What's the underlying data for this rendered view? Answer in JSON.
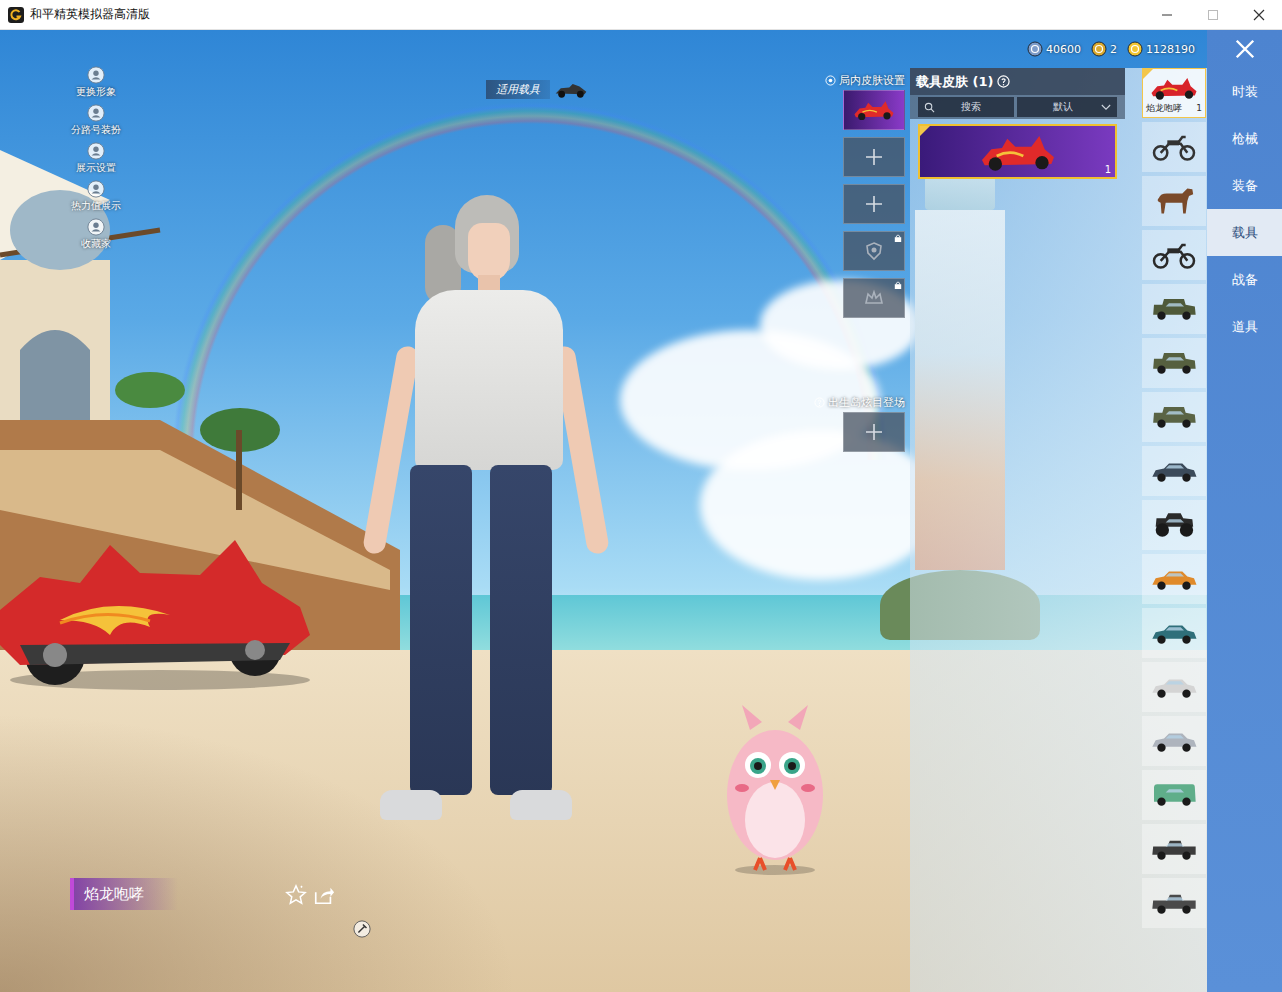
{
  "window": {
    "title": "和平精英模拟器高清版"
  },
  "side_menu": [
    {
      "label": "更换形象"
    },
    {
      "label": "分路号装扮"
    },
    {
      "label": "展示设置"
    },
    {
      "label": "热力值展示"
    },
    {
      "label": "收藏家"
    }
  ],
  "vehicle_hint": {
    "label": "适用载具"
  },
  "currencies": [
    {
      "amount": "40600",
      "color": "#7d9cc9"
    },
    {
      "amount": "2",
      "color": "#d9a92e"
    },
    {
      "amount": "1128190",
      "color": "#f2c531"
    }
  ],
  "skin_slots": {
    "title": "局内皮肤设置",
    "slots": [
      {
        "kind": "skin",
        "locked": false
      },
      {
        "kind": "add",
        "locked": false
      },
      {
        "kind": "add",
        "locked": false
      },
      {
        "kind": "badge",
        "locked": true
      },
      {
        "kind": "crown",
        "locked": true
      }
    ]
  },
  "entrance": {
    "title": "出生岛炫目登场",
    "slots": [
      {
        "kind": "add",
        "locked": false
      }
    ]
  },
  "skin_panel": {
    "title": "载具皮肤 (1)",
    "search": {
      "placeholder": "搜索"
    },
    "sort": {
      "value": "默认"
    },
    "skins": [
      {
        "count": "1",
        "selected": true
      }
    ]
  },
  "vehicles": [
    {
      "kind": "skin",
      "label": "焰龙咆哮",
      "count": "1",
      "selected": true,
      "color": "#d8232a"
    },
    {
      "kind": "motorbike",
      "label": "",
      "count": "",
      "selected": false,
      "color": "#333333"
    },
    {
      "kind": "horse",
      "label": "",
      "count": "",
      "selected": false,
      "color": "#7a4a2a"
    },
    {
      "kind": "motorbike",
      "label": "",
      "count": "",
      "selected": false,
      "color": "#2a2a2a"
    },
    {
      "kind": "jeep",
      "label": "",
      "count": "",
      "selected": false,
      "color": "#4f5a3a"
    },
    {
      "kind": "jeep",
      "label": "",
      "count": "",
      "selected": false,
      "color": "#56603f"
    },
    {
      "kind": "jeep",
      "label": "",
      "count": "",
      "selected": false,
      "color": "#5a6445"
    },
    {
      "kind": "car",
      "label": "",
      "count": "",
      "selected": false,
      "color": "#3b4a5a"
    },
    {
      "kind": "truck",
      "label": "",
      "count": "",
      "selected": false,
      "color": "#2a2a2a"
    },
    {
      "kind": "car",
      "label": "",
      "count": "",
      "selected": false,
      "color": "#e08a2a"
    },
    {
      "kind": "car",
      "label": "",
      "count": "",
      "selected": false,
      "color": "#2f6f7a"
    },
    {
      "kind": "car",
      "label": "",
      "count": "",
      "selected": false,
      "color": "#d4d4d4"
    },
    {
      "kind": "car",
      "label": "",
      "count": "",
      "selected": false,
      "color": "#aeb4bd"
    },
    {
      "kind": "van",
      "label": "",
      "count": "",
      "selected": false,
      "color": "#5fae8a"
    },
    {
      "kind": "pickup",
      "label": "",
      "count": "",
      "selected": false,
      "color": "#3c3c3c"
    },
    {
      "kind": "pickup",
      "label": "",
      "count": "",
      "selected": false,
      "color": "#4a4a4a"
    }
  ],
  "tabs": [
    {
      "label": "时装",
      "selected": false
    },
    {
      "label": "枪械",
      "selected": false
    },
    {
      "label": "装备",
      "selected": false
    },
    {
      "label": "载具",
      "selected": true
    },
    {
      "label": "战备",
      "selected": false
    },
    {
      "label": "道具",
      "selected": false
    }
  ],
  "current_skin": {
    "name": "焰龙咆哮"
  }
}
